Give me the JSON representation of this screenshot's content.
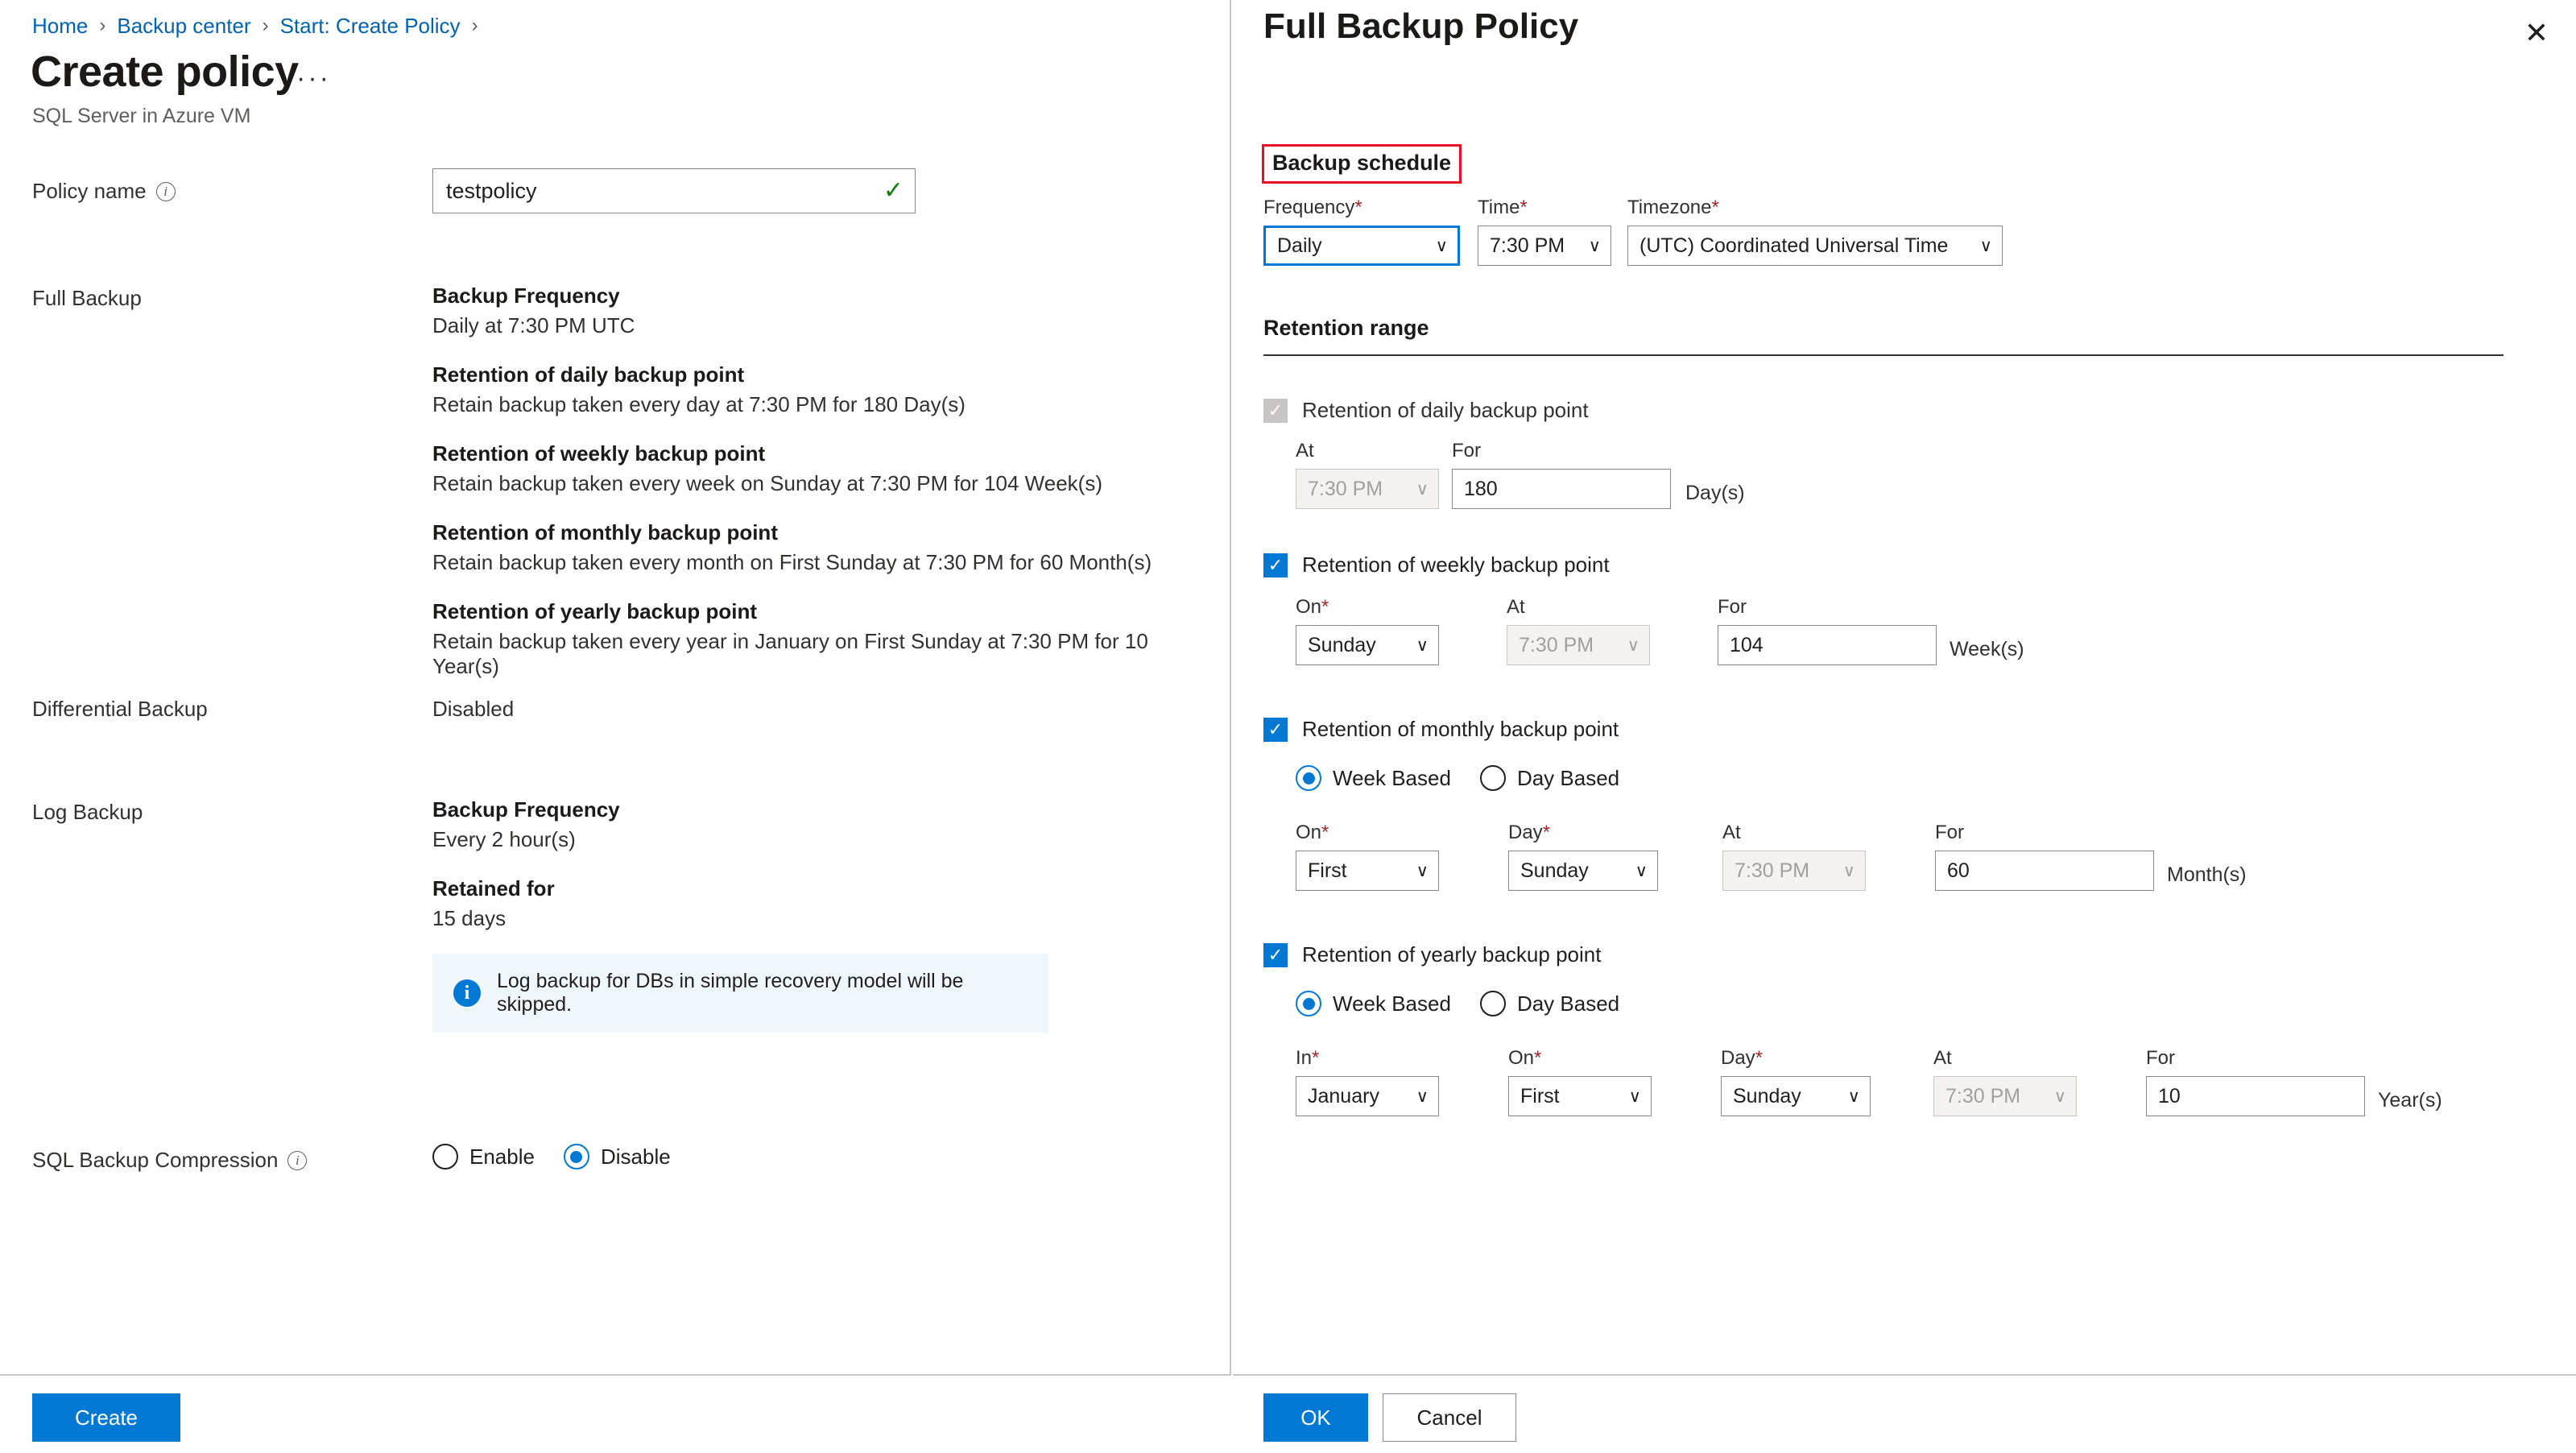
{
  "breadcrumb": {
    "items": [
      "Home",
      "Backup center",
      "Start: Create Policy"
    ],
    "separator": "›"
  },
  "header": {
    "title": "Create policy",
    "ellipsis": "···",
    "subtitle": "SQL Server in Azure VM"
  },
  "left": {
    "policy_name": {
      "label": "Policy name",
      "info_glyph": "i",
      "value": "testpolicy",
      "placeholder": "Policy name",
      "valid_glyph": "✓"
    },
    "full_backup": {
      "label": "Full Backup",
      "frequency_heading": "Backup Frequency",
      "frequency_text": "Daily at 7:30 PM UTC",
      "daily_heading": "Retention of daily backup point",
      "daily_text": "Retain backup taken every day at 7:30 PM for 180 Day(s)",
      "weekly_heading": "Retention of weekly backup point",
      "weekly_text": "Retain backup taken every week on Sunday at 7:30 PM for 104 Week(s)",
      "monthly_heading": "Retention of monthly backup point",
      "monthly_text": "Retain backup taken every month on First Sunday at 7:30 PM for 60 Month(s)",
      "yearly_heading": "Retention of yearly backup point",
      "yearly_text": "Retain backup taken every year in January on First Sunday at 7:30 PM for 10 Year(s)"
    },
    "differential_backup": {
      "label": "Differential Backup",
      "value": "Disabled"
    },
    "log_backup": {
      "label": "Log Backup",
      "frequency_heading": "Backup Frequency",
      "frequency_text": "Every 2 hour(s)",
      "retained_heading": "Retained for",
      "retained_text": "15 days",
      "info_glyph": "i",
      "info_text": "Log backup for DBs in simple recovery model will be skipped."
    },
    "compression": {
      "label": "SQL Backup Compression",
      "info_glyph": "i",
      "options": [
        "Enable",
        "Disable"
      ],
      "selected": "Disable"
    },
    "create_button": "Create"
  },
  "right": {
    "title": "Full Backup Policy",
    "close_glyph": "✕",
    "backup_schedule": {
      "heading": "Backup schedule",
      "frequency": {
        "label": "Frequency",
        "required": "*",
        "value": "Daily",
        "chevron": "∨"
      },
      "time": {
        "label": "Time",
        "required": "*",
        "value": "7:30 PM",
        "chevron": "∨"
      },
      "timezone": {
        "label": "Timezone",
        "required": "*",
        "value": "(UTC) Coordinated Universal Time",
        "chevron": "∨"
      }
    },
    "retention_range": {
      "heading": "Retention range",
      "daily": {
        "checkbox_label": "Retention of daily backup point",
        "checked": true,
        "disabled": true,
        "check_glyph": "✓",
        "at_label": "At",
        "at_value": "7:30 PM",
        "for_label": "For",
        "for_value": "180",
        "unit": "Day(s)"
      },
      "weekly": {
        "checkbox_label": "Retention of weekly backup point",
        "checked": true,
        "check_glyph": "✓",
        "on_label": "On",
        "on_required": "*",
        "on_value": "Sunday",
        "at_label": "At",
        "at_value": "7:30 PM",
        "for_label": "For",
        "for_value": "104",
        "unit": "Week(s)"
      },
      "monthly": {
        "checkbox_label": "Retention of monthly backup point",
        "checked": true,
        "check_glyph": "✓",
        "mode_options": [
          "Week Based",
          "Day Based"
        ],
        "mode_selected": "Week Based",
        "on_label": "On",
        "on_required": "*",
        "on_value": "First",
        "day_label": "Day",
        "day_required": "*",
        "day_value": "Sunday",
        "at_label": "At",
        "at_value": "7:30 PM",
        "for_label": "For",
        "for_value": "60",
        "unit": "Month(s)"
      },
      "yearly": {
        "checkbox_label": "Retention of yearly backup point",
        "checked": true,
        "check_glyph": "✓",
        "mode_options": [
          "Week Based",
          "Day Based"
        ],
        "mode_selected": "Week Based",
        "in_label": "In",
        "in_required": "*",
        "in_value": "January",
        "on_label": "On",
        "on_required": "*",
        "on_value": "First",
        "day_label": "Day",
        "day_required": "*",
        "day_value": "Sunday",
        "at_label": "At",
        "at_value": "7:30 PM",
        "for_label": "For",
        "for_value": "10",
        "unit": "Year(s)"
      }
    },
    "ok_button": "OK",
    "cancel_button": "Cancel"
  },
  "colors": {
    "accent": "#0078d4",
    "link": "#0063b1",
    "highlight_box": "#e81123",
    "success": "#107c10",
    "info_bg": "#eff6fc",
    "disabled_bg": "#f3f2f1"
  }
}
